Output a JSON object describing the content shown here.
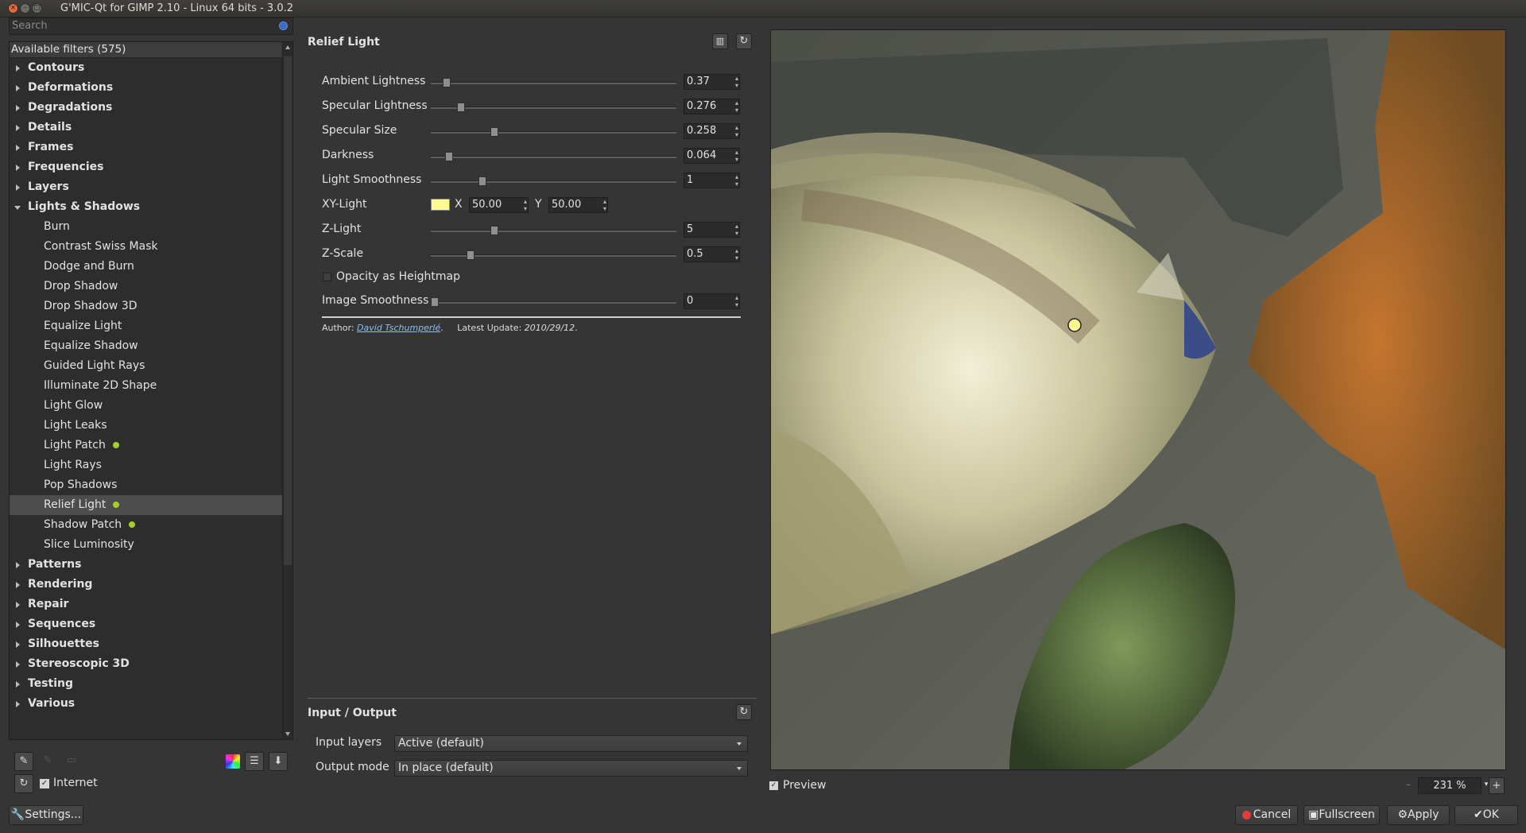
{
  "window": {
    "title": "G'MIC-Qt for GIMP 2.10 - Linux 64 bits - 3.0.2"
  },
  "search": {
    "placeholder": "Search"
  },
  "tree": {
    "header": "Available filters (575)",
    "items": [
      {
        "label": "Contours",
        "type": "cat"
      },
      {
        "label": "Deformations",
        "type": "cat"
      },
      {
        "label": "Degradations",
        "type": "cat"
      },
      {
        "label": "Details",
        "type": "cat"
      },
      {
        "label": "Frames",
        "type": "cat"
      },
      {
        "label": "Frequencies",
        "type": "cat"
      },
      {
        "label": "Layers",
        "type": "cat"
      },
      {
        "label": "Lights & Shadows",
        "type": "cat",
        "open": true
      },
      {
        "label": "Burn",
        "type": "leaf"
      },
      {
        "label": "Contrast Swiss Mask",
        "type": "leaf"
      },
      {
        "label": "Dodge and Burn",
        "type": "leaf"
      },
      {
        "label": "Drop Shadow",
        "type": "leaf"
      },
      {
        "label": "Drop Shadow 3D",
        "type": "leaf"
      },
      {
        "label": "Equalize Light",
        "type": "leaf"
      },
      {
        "label": "Equalize Shadow",
        "type": "leaf"
      },
      {
        "label": "Guided Light Rays",
        "type": "leaf"
      },
      {
        "label": "Illuminate 2D Shape",
        "type": "leaf"
      },
      {
        "label": "Light Glow",
        "type": "leaf"
      },
      {
        "label": "Light Leaks",
        "type": "leaf"
      },
      {
        "label": "Light Patch",
        "type": "leaf",
        "fav": true
      },
      {
        "label": "Light Rays",
        "type": "leaf"
      },
      {
        "label": "Pop Shadows",
        "type": "leaf"
      },
      {
        "label": "Relief Light",
        "type": "leaf",
        "fav": true,
        "selected": true
      },
      {
        "label": "Shadow Patch",
        "type": "leaf",
        "fav": true
      },
      {
        "label": "Slice Luminosity",
        "type": "leaf"
      },
      {
        "label": "Patterns",
        "type": "cat"
      },
      {
        "label": "Rendering",
        "type": "cat"
      },
      {
        "label": "Repair",
        "type": "cat"
      },
      {
        "label": "Sequences",
        "type": "cat"
      },
      {
        "label": "Silhouettes",
        "type": "cat"
      },
      {
        "label": "Stereoscopic 3D",
        "type": "cat"
      },
      {
        "label": "Testing",
        "type": "cat"
      },
      {
        "label": "Various",
        "type": "cat"
      }
    ]
  },
  "internet": {
    "label": "Internet",
    "checked": true
  },
  "settings_button": "Settings...",
  "filter": {
    "name": "Relief Light",
    "params": [
      {
        "label": "Ambient Lightness",
        "value": "0.37",
        "level": 0.05
      },
      {
        "label": "Specular Lightness",
        "value": "0.276",
        "level": 0.11
      },
      {
        "label": "Specular Size",
        "value": "0.258",
        "level": 0.25
      },
      {
        "label": "Darkness",
        "value": "0.064",
        "level": 0.06
      },
      {
        "label": "Light Smoothness",
        "value": "1",
        "level": 0.2
      },
      {
        "label": "XY-Light",
        "type": "point",
        "x_label": "X",
        "x": "50.00",
        "y_label": "Y",
        "y": "50.00",
        "color": "#fffa8f"
      },
      {
        "label": "Z-Light",
        "value": "5",
        "level": 0.25
      },
      {
        "label": "Z-Scale",
        "value": "0.5",
        "level": 0.15
      },
      {
        "label": "Opacity as Heightmap",
        "type": "bool",
        "checked": false
      },
      {
        "label": "Image Smoothness",
        "value": "0",
        "level": 0
      }
    ],
    "author_prefix": "Author: ",
    "author": "David Tschumperlé",
    "author_suffix": ".",
    "update_prefix": "Latest Update: ",
    "update": "2010/29/12",
    "update_suffix": "."
  },
  "io": {
    "title": "Input / Output",
    "input_label": "Input layers",
    "input_value": "Active (default)",
    "output_label": "Output mode",
    "output_value": "In place (default)"
  },
  "preview": {
    "label": "Preview",
    "checked": true,
    "zoom": "231 %"
  },
  "buttons": {
    "cancel": "Cancel",
    "fullscreen": "Fullscreen",
    "apply": "Apply",
    "ok": "OK"
  },
  "colors": {
    "accent_fav": "#a7ce2a",
    "light_point": "#fffa8f"
  }
}
